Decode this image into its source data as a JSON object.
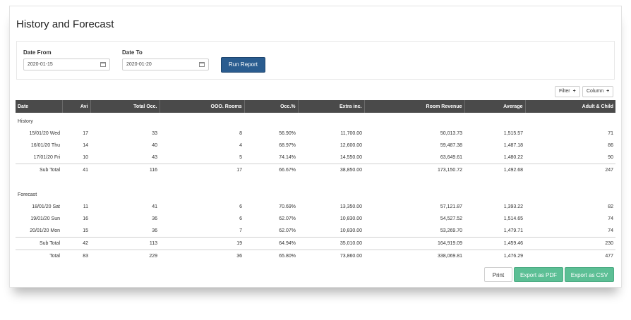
{
  "page": {
    "title": "History and Forecast"
  },
  "filters": {
    "date_from_label": "Date From",
    "date_from_value": "2020-01-15",
    "date_to_label": "Date To",
    "date_to_value": "2020-01-20",
    "run_label": "Run Report"
  },
  "toolbar": {
    "filter_label": "Filter",
    "column_label": "Column",
    "plus": "+"
  },
  "table": {
    "headers": [
      "Date",
      "Avi",
      "Total Occ.",
      "OOO. Rooms",
      "Occ.%",
      "Extra inc.",
      "Room Revenue",
      "Average",
      "Adult & Child"
    ],
    "history_label": "History",
    "history_rows": [
      [
        "15/01/20 Wed",
        "17",
        "33",
        "8",
        "56.90%",
        "11,700.00",
        "50,013.73",
        "1,515.57",
        "71"
      ],
      [
        "16/01/20 Thu",
        "14",
        "40",
        "4",
        "68.97%",
        "12,600.00",
        "59,487.38",
        "1,487.18",
        "86"
      ],
      [
        "17/01/20 Fri",
        "10",
        "43",
        "5",
        "74.14%",
        "14,550.00",
        "63,649.61",
        "1,480.22",
        "90"
      ]
    ],
    "history_subtotal": [
      "Sub Total",
      "41",
      "116",
      "17",
      "66.67%",
      "38,850.00",
      "173,150.72",
      "1,492.68",
      "247"
    ],
    "forecast_label": "Forecast",
    "forecast_rows": [
      [
        "18/01/20 Sat",
        "11",
        "41",
        "6",
        "70.69%",
        "13,350.00",
        "57,121.87",
        "1,393.22",
        "82"
      ],
      [
        "19/01/20 Sun",
        "16",
        "36",
        "6",
        "62.07%",
        "10,830.00",
        "54,527.52",
        "1,514.65",
        "74"
      ],
      [
        "20/01/20 Mon",
        "15",
        "36",
        "7",
        "62.07%",
        "10,830.00",
        "53,269.70",
        "1,479.71",
        "74"
      ]
    ],
    "forecast_subtotal": [
      "Sub Total",
      "42",
      "113",
      "19",
      "64.94%",
      "35,010.00",
      "164,919.09",
      "1,459.46",
      "230"
    ],
    "total": [
      "Total",
      "83",
      "229",
      "36",
      "65.80%",
      "73,860.00",
      "338,069.81",
      "1,476.29",
      "477"
    ]
  },
  "footer": {
    "print_label": "Print",
    "pdf_label": "Export as PDF",
    "csv_label": "Export as CSV"
  },
  "colors": {
    "header_bg": "#4a4a4a",
    "primary": "#2a5c8f",
    "export": "#5cbf95"
  }
}
